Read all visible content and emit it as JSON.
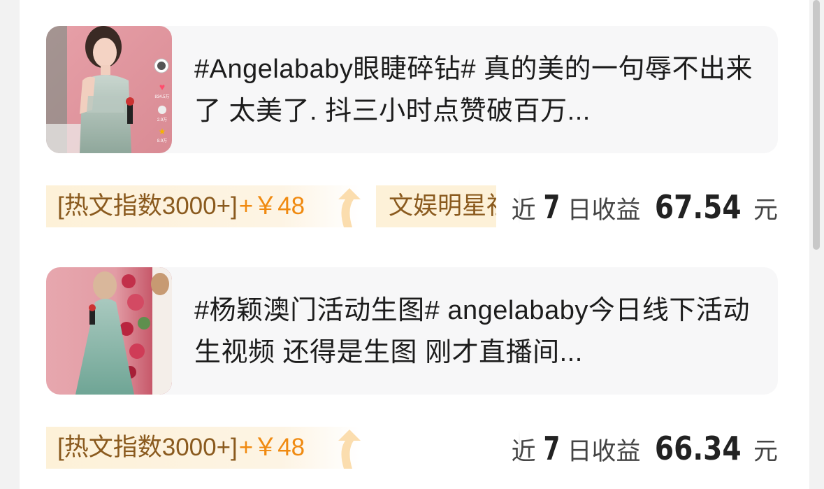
{
  "colors": {
    "tag_bg": "#fdf1d8",
    "tag_text": "#8a5a1e",
    "accent_orange": "#f08a10",
    "card_bg": "#f7f7f8"
  },
  "feed": [
    {
      "title": "#Angelababy眼睫碎钻# 真的美的一句辱不出来了 太美了. 抖三小时点赞破百万...",
      "hot_tag": "[热文指数3000+]",
      "reward": "+￥48",
      "category": "文娱明星社",
      "earn_prefix": "近",
      "earn_days": "7",
      "earn_mid": "日收益",
      "earn_value": "67.54",
      "earn_unit": "元",
      "thumb_side_stats": [
        "834.5万",
        "2.9万",
        "8.9万"
      ]
    },
    {
      "title": "#杨颖澳门活动生图# angelababy今日线下活动生视频 还得是生图 刚才直播间...",
      "hot_tag": "[热文指数3000+]",
      "reward": "+￥48",
      "earn_prefix": "近",
      "earn_days": "7",
      "earn_mid": "日收益",
      "earn_value": "66.34",
      "earn_unit": "元"
    }
  ]
}
